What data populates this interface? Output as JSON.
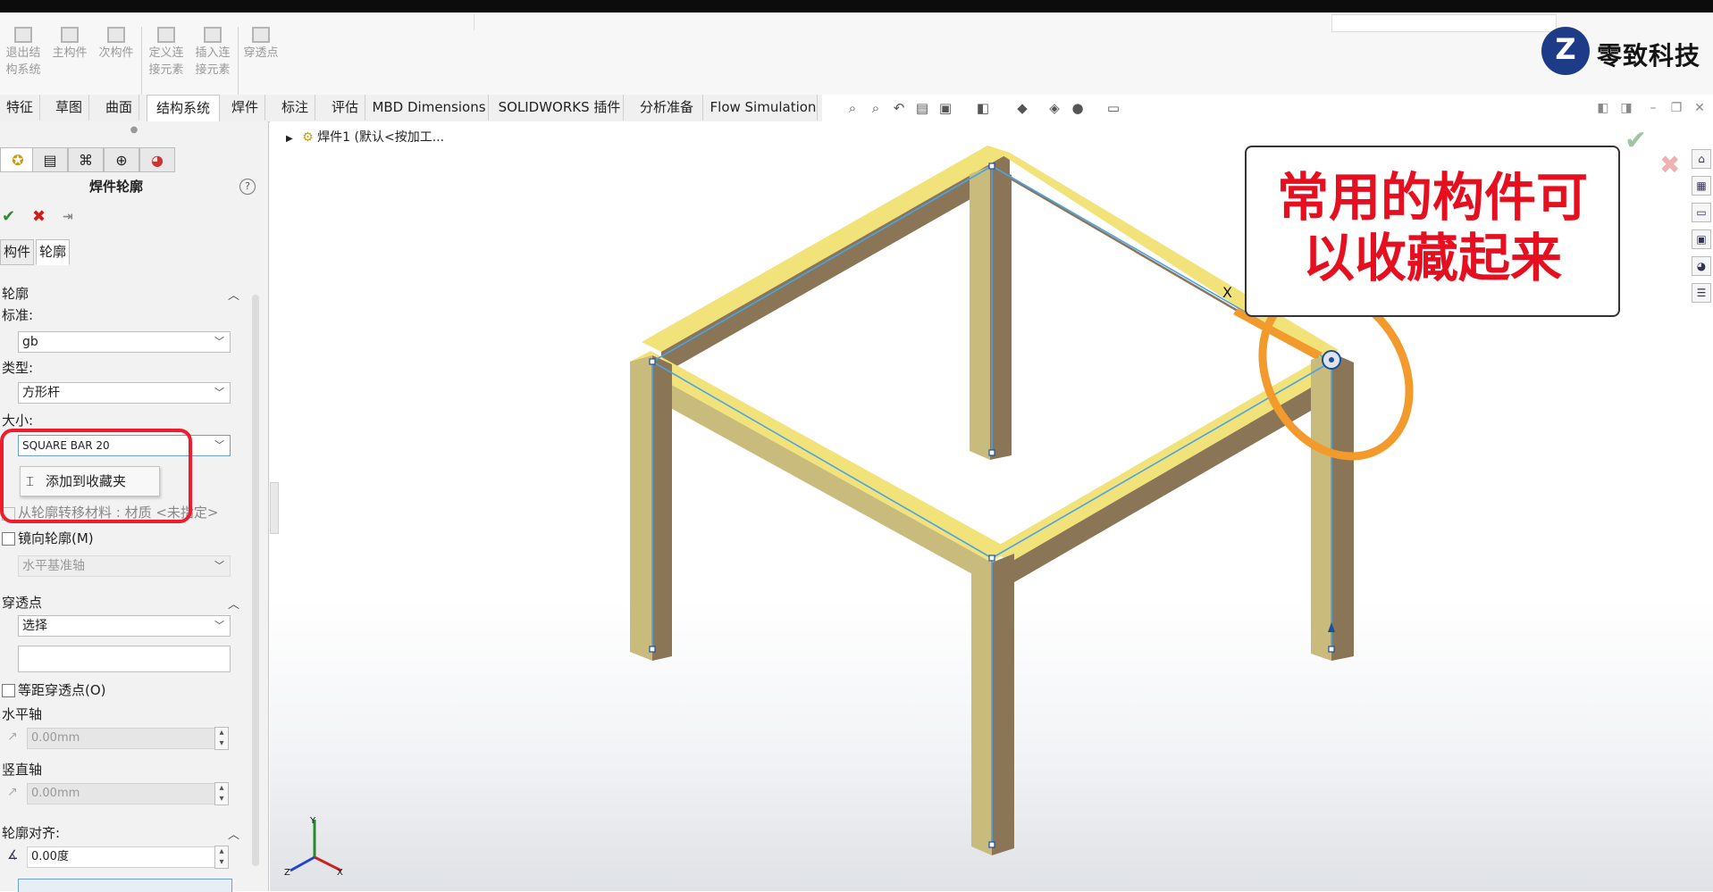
{
  "ribbon": {
    "buttons": [
      {
        "label_l1": "退出结",
        "label_l2": "构系统",
        "icon": "exit-structure-icon"
      },
      {
        "label_l1": "主构件",
        "label_l2": "",
        "icon": "primary-member-icon"
      },
      {
        "label_l1": "次构件",
        "label_l2": "",
        "icon": "secondary-member-icon"
      },
      {
        "label_l1": "定义连",
        "label_l2": "接元素",
        "icon": "define-connection-icon"
      },
      {
        "label_l1": "插入连",
        "label_l2": "接元素",
        "icon": "insert-connection-icon"
      },
      {
        "label_l1": "穿透点",
        "label_l2": "",
        "icon": "pierce-point-icon"
      }
    ]
  },
  "logo": {
    "mark": "Z",
    "text": "零致科技"
  },
  "tabs": [
    "特征",
    "草图",
    "曲面",
    "结构系统",
    "焊件",
    "标注",
    "评估",
    "MBD Dimensions",
    "SOLIDWORKS 插件",
    "分析准备",
    "Flow Simulation"
  ],
  "active_tab": "结构系统",
  "panel": {
    "title": "焊件轮廓",
    "help": "?",
    "ok": "✔",
    "cancel": "✖",
    "pin": "⇥",
    "subtabs": [
      "构件",
      "轮廓"
    ],
    "profile_section": "轮廓",
    "standard_label": "标准:",
    "standard_value": "gb",
    "type_label": "类型:",
    "type_value": "方形杆",
    "size_label": "大小:",
    "size_value": "SQUARE BAR 20",
    "context_menu_item": "添加到收藏夹",
    "transfer_material_label": "从轮廓转移材料 : 材质 <未指定>",
    "mirror_profile_label": "镜向轮廓(M)",
    "mirror_axis_value": "水平基准轴",
    "pierce_section": "穿透点",
    "pierce_select_value": "选择",
    "pierce_input_value": "",
    "equidistant_label": "等距穿透点(O)",
    "horizontal_axis_label": "水平轴",
    "horizontal_value": "0.00mm",
    "vertical_axis_label": "竖直轴",
    "vertical_value": "0.00mm",
    "align_section": "轮廓对齐:",
    "angle_value": "0.00度"
  },
  "tree": {
    "root_label": "焊件1 (默认<按加工..."
  },
  "callout": {
    "line1": "常用的构件可",
    "line2": "以收藏起来"
  },
  "viewport": {
    "vertex_label": "X"
  },
  "triad": {
    "x": "X",
    "y": "Y",
    "z": "Z"
  },
  "colors": {
    "beam_top": "#f2e27a",
    "beam_side_light": "#c9bb7c",
    "beam_side_dark": "#8a7556",
    "sketch_line": "#4aa3e8",
    "highlight_red": "#ee1c2c",
    "annotation_orange": "#f39a2c",
    "logo_blue": "#1d3b86"
  }
}
